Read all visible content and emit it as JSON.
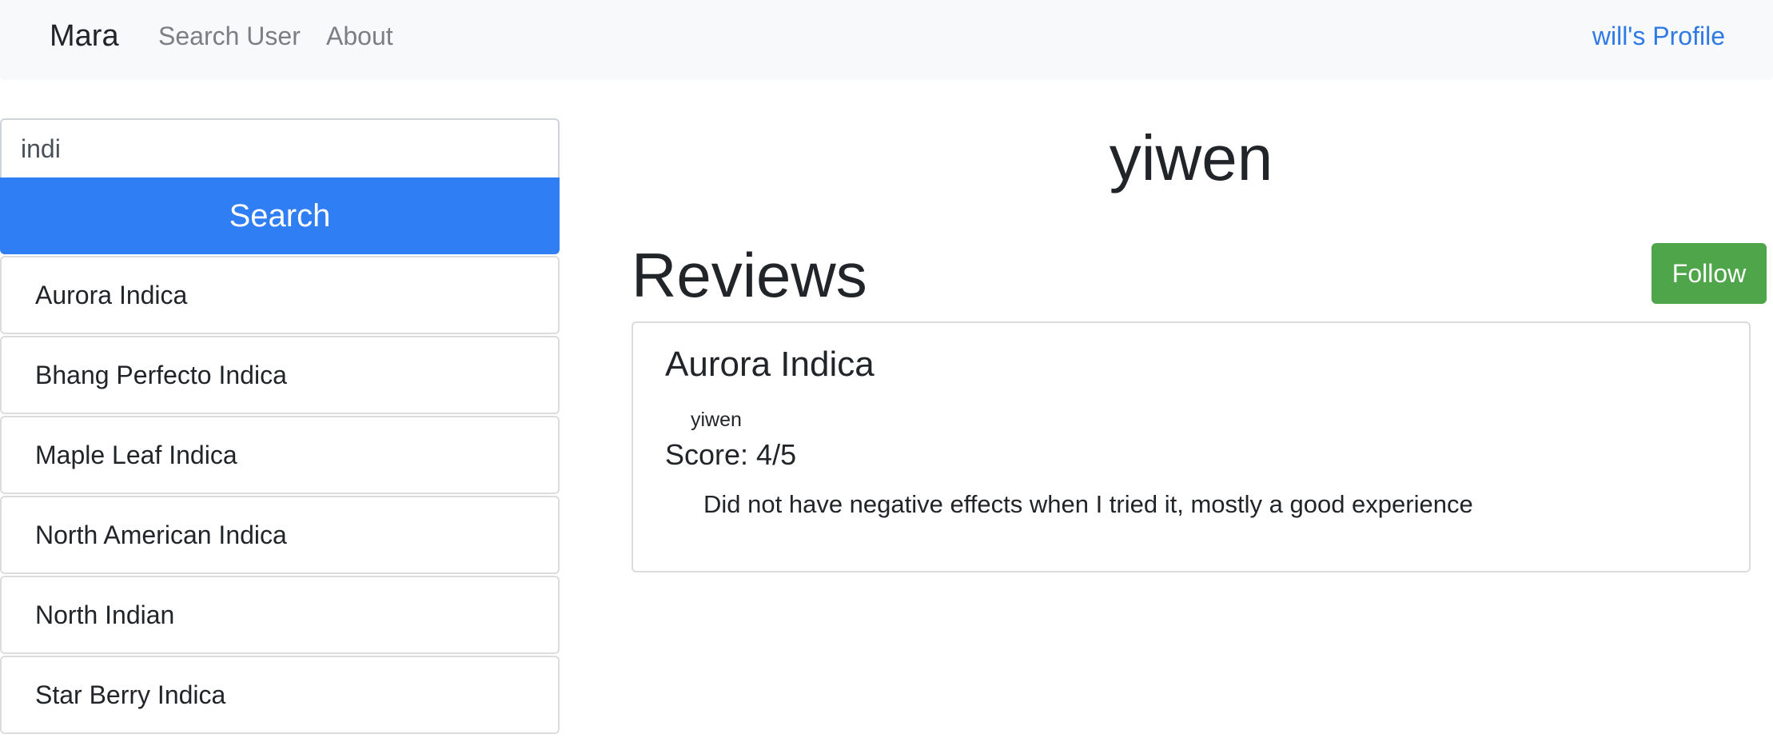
{
  "navbar": {
    "brand": "Mara",
    "links": [
      {
        "label": "Search User"
      },
      {
        "label": "About"
      }
    ],
    "profile_label": "will's Profile"
  },
  "sidebar": {
    "search_value": "indi",
    "search_button_label": "Search",
    "results": [
      {
        "label": "Aurora Indica"
      },
      {
        "label": "Bhang Perfecto Indica"
      },
      {
        "label": "Maple Leaf Indica"
      },
      {
        "label": "North American Indica"
      },
      {
        "label": "North Indian"
      },
      {
        "label": "Star Berry Indica"
      }
    ]
  },
  "main": {
    "username": "yiwen",
    "reviews_heading": "Reviews",
    "follow_label": "Follow",
    "reviews": [
      {
        "strain": "Aurora Indica",
        "author": "yiwen",
        "score": "Score: 4/5",
        "text": "Did not have negative effects when I tried it, mostly a good experience"
      }
    ]
  },
  "colors": {
    "primary": "#2f7ef3",
    "success": "#4fa54a",
    "link": "#2f7ae5",
    "navbar_bg": "#f8f9fa"
  }
}
